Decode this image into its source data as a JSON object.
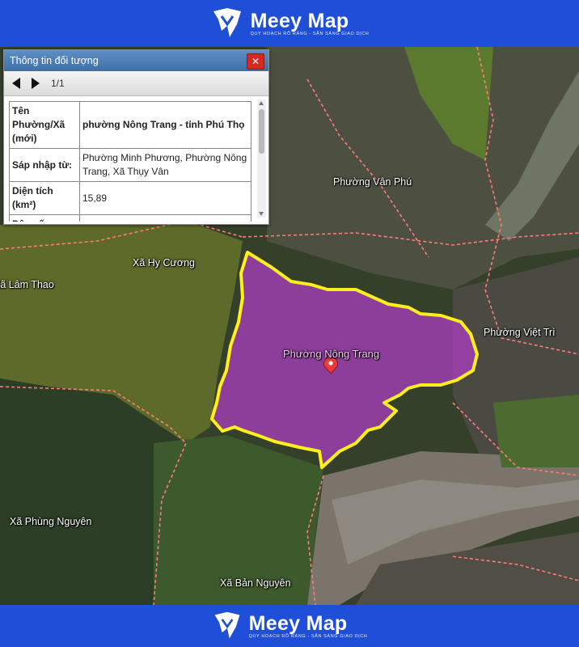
{
  "brand": {
    "name": "Meey Map",
    "tagline": "QUY HOẠCH RÕ RÀNG - SẴN SÀNG GIAO DỊCH"
  },
  "panel": {
    "title": "Thông tin đối tượng",
    "close_label": "✕",
    "page": "1/1",
    "rows": [
      {
        "key": "Tên Phường/Xã (mới)",
        "value": "phường Nông Trang - tỉnh Phú Thọ"
      },
      {
        "key": "Sáp nhập từ:",
        "value": "Phường Minh Phương, Phường Nông Trang, Xã Thụy Vân"
      },
      {
        "key": "Diện tích (km²)",
        "value": "15,89"
      },
      {
        "key": "Dân số",
        "value": ""
      }
    ]
  },
  "map": {
    "highlight_color": "#b03dc8",
    "boundary_color": "#ffef1a",
    "admin_line_color": "#ff7a7a",
    "places": {
      "van_phu": "Phường Vân Phú",
      "hy_cuong": "Xã Hy Cương",
      "lam_thao": "Xã Lâm Thao",
      "nong_trang": "Phường Nông Trang",
      "viet_tri": "Phường Việt Trì",
      "phung_nguyen": "Xã Phùng Nguyên",
      "ban_nguyen": "Xã Bản Nguyên"
    }
  }
}
